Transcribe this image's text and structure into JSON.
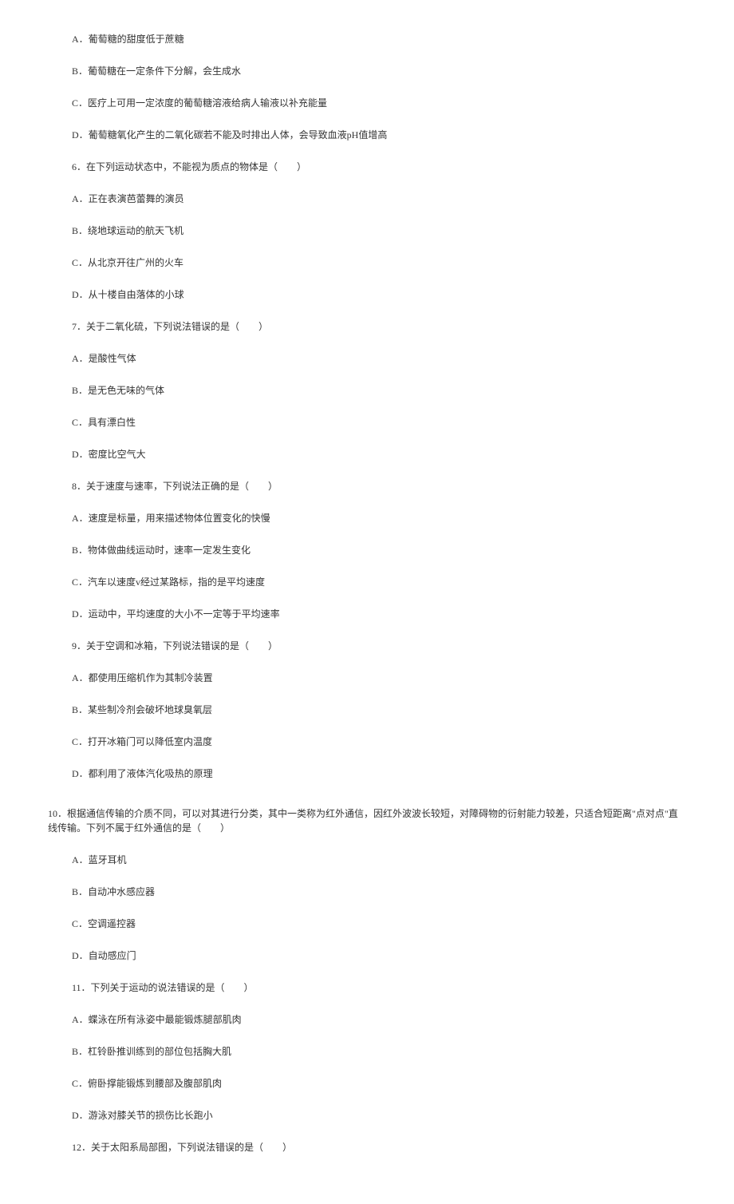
{
  "items": [
    {
      "indent": "sub",
      "text": "A．葡萄糖的甜度低于蔗糖"
    },
    {
      "indent": "sub",
      "text": "B．葡萄糖在一定条件下分解，会生成水"
    },
    {
      "indent": "sub",
      "text": "C．医疗上可用一定浓度的葡萄糖溶液给病人输液以补充能量"
    },
    {
      "indent": "sub",
      "text": "D．葡萄糖氧化产生的二氧化碳若不能及时排出人体，会导致血液pH值增高"
    },
    {
      "indent": "sub",
      "text": "6．在下列运动状态中，不能视为质点的物体是（　　）"
    },
    {
      "indent": "sub",
      "text": "A．正在表演芭蕾舞的演员"
    },
    {
      "indent": "sub",
      "text": "B．绕地球运动的航天飞机"
    },
    {
      "indent": "sub",
      "text": "C．从北京开往广州的火车"
    },
    {
      "indent": "sub",
      "text": "D．从十楼自由落体的小球"
    },
    {
      "indent": "sub",
      "text": "7．关于二氧化硫，下列说法错误的是（　　）"
    },
    {
      "indent": "sub",
      "text": "A．是酸性气体"
    },
    {
      "indent": "sub",
      "text": "B．是无色无味的气体"
    },
    {
      "indent": "sub",
      "text": "C．具有漂白性"
    },
    {
      "indent": "sub",
      "text": "D．密度比空气大"
    },
    {
      "indent": "sub",
      "text": "8．关于速度与速率，下列说法正确的是（　　）"
    },
    {
      "indent": "sub",
      "text": "A．速度是标量，用来描述物体位置变化的快慢"
    },
    {
      "indent": "sub",
      "text": "B．物体做曲线运动时，速率一定发生变化"
    },
    {
      "indent": "sub",
      "text": "C．汽车以速度v经过某路标，指的是平均速度"
    },
    {
      "indent": "sub",
      "text": "D．运动中，平均速度的大小不一定等于平均速率"
    },
    {
      "indent": "sub",
      "text": "9．关于空调和冰箱，下列说法错误的是（　　）"
    },
    {
      "indent": "sub",
      "text": "A．都使用压缩机作为其制冷装置"
    },
    {
      "indent": "sub",
      "text": "B．某些制冷剂会破坏地球臭氧层"
    },
    {
      "indent": "sub",
      "text": "C．打开冰箱门可以降低室内温度"
    },
    {
      "indent": "sub",
      "text": "D．都利用了液体汽化吸热的原理"
    },
    {
      "indent": "spacer",
      "text": ""
    },
    {
      "indent": "main",
      "text": "10．根据通信传输的介质不同，可以对其进行分类，其中一类称为红外通信，因红外波波长较短，对障碍物的衍射能力较差，只适合短距离\"点对点\"直线传输。下列不属于红外通信的是（　　）"
    },
    {
      "indent": "sub",
      "text": "A．蓝牙耳机"
    },
    {
      "indent": "sub",
      "text": "B．自动冲水感应器"
    },
    {
      "indent": "sub",
      "text": "C．空调遥控器"
    },
    {
      "indent": "sub",
      "text": "D．自动感应门"
    },
    {
      "indent": "sub",
      "text": "11．下列关于运动的说法错误的是（　　）"
    },
    {
      "indent": "sub",
      "text": "A．蝶泳在所有泳姿中最能锻炼腿部肌肉"
    },
    {
      "indent": "sub",
      "text": "B．杠铃卧推训练到的部位包括胸大肌"
    },
    {
      "indent": "sub",
      "text": "C．俯卧撑能锻炼到腰部及腹部肌肉"
    },
    {
      "indent": "sub",
      "text": "D．游泳对膝关节的损伤比长跑小"
    },
    {
      "indent": "sub",
      "text": "12．关于太阳系局部图，下列说法错误的是（　　）"
    }
  ]
}
